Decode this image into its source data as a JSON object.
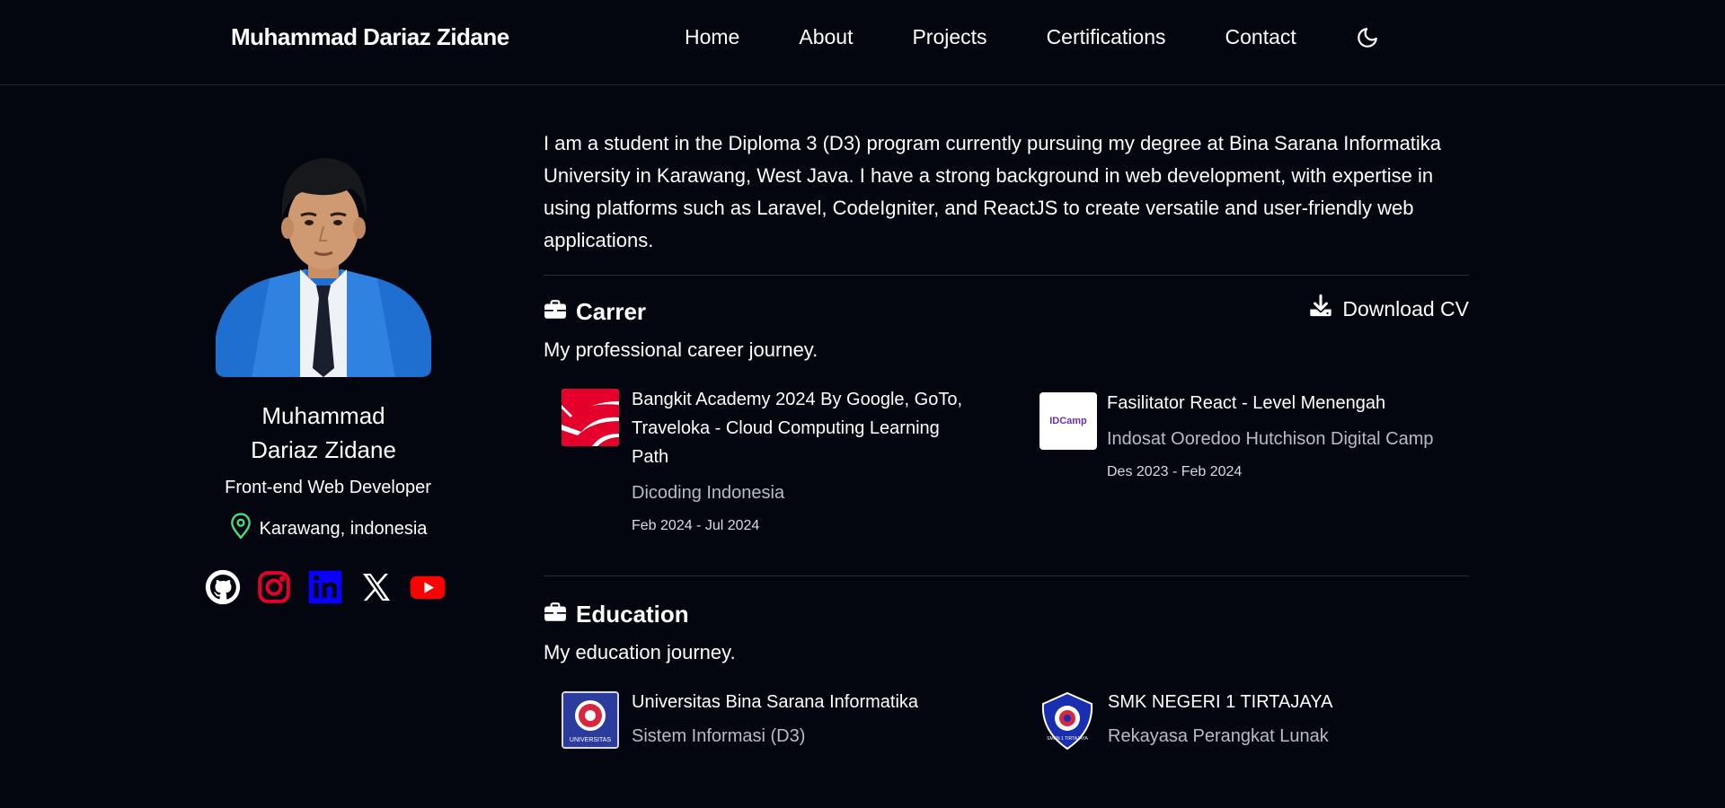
{
  "header": {
    "brand": "Muhammad Dariaz Zidane",
    "nav": [
      "Home",
      "About",
      "Projects",
      "Certifications",
      "Contact"
    ],
    "theme_icon": "moon-icon"
  },
  "profile": {
    "name": "Muhammad Dariaz Zidane",
    "role": "Front-end Web Developer",
    "location": "Karawang, indonesia",
    "socials": [
      "github-icon",
      "instagram-icon",
      "linkedin-icon",
      "x-icon",
      "youtube-icon"
    ],
    "colors": {
      "location_pin": "#4ade80",
      "instagram": "#e4002b",
      "linkedin": "#0a00ff",
      "youtube": "#ff0000",
      "jacket": "#1e6fd0"
    }
  },
  "about": {
    "text": "I am a student in the Diploma 3 (D3) program currently pursuing my degree at Bina Sarana Informatika University in Karawang, West Java. I have a strong background in web development, with expertise in using platforms such as Laravel, CodeIgniter, and ReactJS to create versatile and user-friendly web applications."
  },
  "career": {
    "title": "Carrer",
    "subtitle": "My professional career journey.",
    "download_label": "Download CV",
    "items": [
      {
        "title": "Bangkit Academy 2024 By Google, GoTo, Traveloka - Cloud Computing Learning Path",
        "org": "Dicoding Indonesia",
        "date": "Feb 2024 - Jul 2024",
        "logo": "bangkit-logo"
      },
      {
        "title": "Fasilitator React - Level Menengah",
        "org": "Indosat Ooredoo Hutchison Digital Camp",
        "date": "Des 2023 - Feb 2024",
        "logo": "idcamp-logo",
        "logo_text": "IDCamp"
      }
    ]
  },
  "education": {
    "title": "Education",
    "subtitle": "My education journey.",
    "items": [
      {
        "title": "Universitas Bina Sarana Informatika",
        "org": "Sistem Informasi (D3)",
        "logo": "ubsi-logo",
        "logo_text": "UNIVERSITAS"
      },
      {
        "title": "SMK NEGERI 1 TIRTAJAYA",
        "org": "Rekayasa Perangkat Lunak",
        "logo": "smkn1-logo",
        "logo_text": "SMKN 1 TIRTAJAYA"
      }
    ]
  }
}
